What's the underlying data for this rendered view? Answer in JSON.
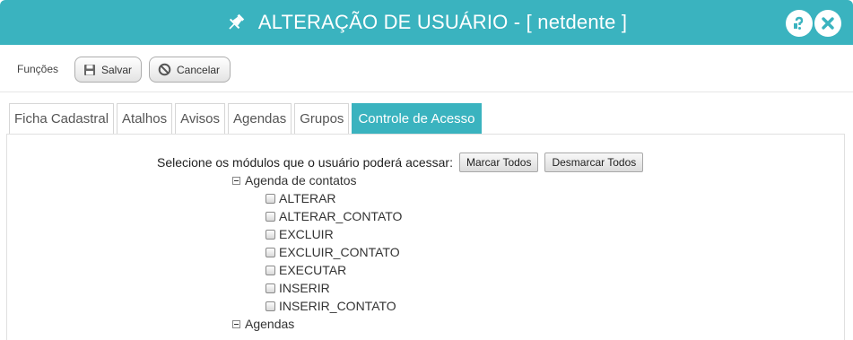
{
  "window": {
    "title": "ALTERAÇÃO DE USUÁRIO - [ netdente ]",
    "accent_color": "#3ab3bf",
    "icons": [
      "pin-icon",
      "help-icon",
      "close-icon"
    ]
  },
  "toolbar": {
    "label": "Funções",
    "save_label": "Salvar",
    "cancel_label": "Cancelar"
  },
  "tabs": [
    {
      "label": "Ficha Cadastral",
      "active": false
    },
    {
      "label": "Atalhos",
      "active": false
    },
    {
      "label": "Avisos",
      "active": false
    },
    {
      "label": "Agendas",
      "active": false
    },
    {
      "label": "Grupos",
      "active": false
    },
    {
      "label": "Controle de Acesso",
      "active": true
    }
  ],
  "access": {
    "prompt": "Selecione os módulos que o usuário poderá acessar:",
    "select_all_label": "Marcar Todos",
    "deselect_all_label": "Desmarcar Todos",
    "groups": [
      {
        "label": "Agenda de contatos",
        "items": [
          "ALTERAR",
          "ALTERAR_CONTATO",
          "EXCLUIR",
          "EXCLUIR_CONTATO",
          "EXECUTAR",
          "INSERIR",
          "INSERIR_CONTATO"
        ]
      },
      {
        "label": "Agendas",
        "items": []
      }
    ]
  }
}
